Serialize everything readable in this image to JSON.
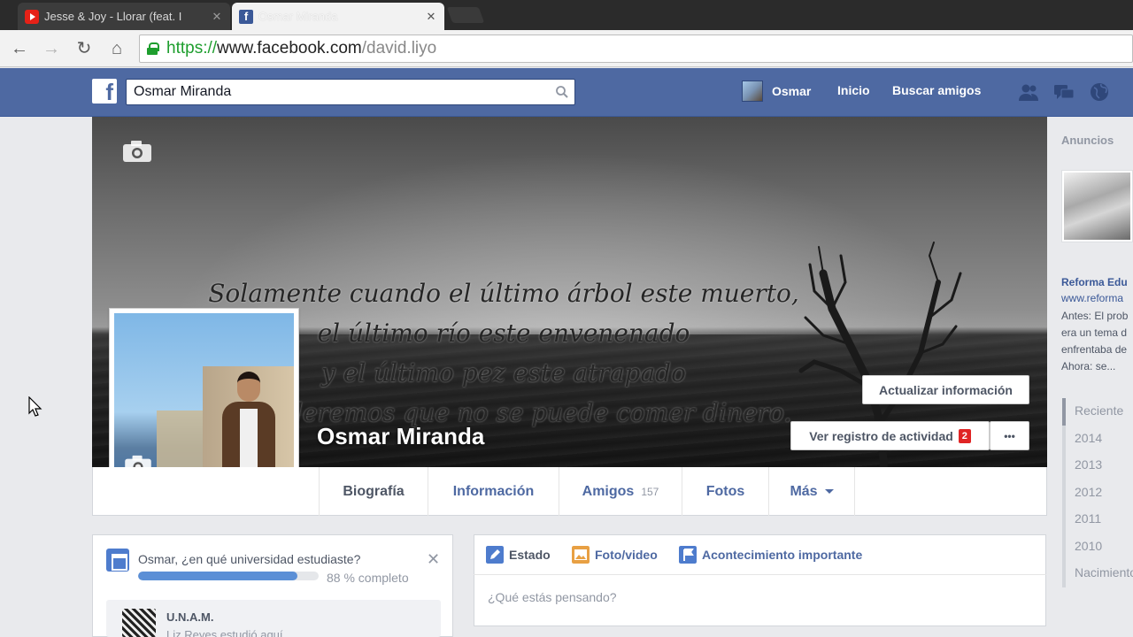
{
  "browser": {
    "tabs": [
      {
        "title": "Jesse & Joy - Llorar (feat. I",
        "active": false
      },
      {
        "title": "Osmar Miranda",
        "active": true
      }
    ],
    "url": {
      "scheme": "https://",
      "host": "www.facebook.com",
      "path": "/david.liyo"
    }
  },
  "fb": {
    "search_value": "Osmar Miranda",
    "user_name": "Osmar",
    "nav": {
      "home": "Inicio",
      "find_friends": "Buscar amigos"
    }
  },
  "cover": {
    "quote_lines": [
      "Solamente cuando el último árbol este muerto,",
      "el último río este envenenado",
      "y el último pez este atrapado",
      "entenderemos que no se puede comer dinero."
    ],
    "update_info_label": "Actualizar información",
    "activity_log_label": "Ver registro de actividad",
    "activity_badge": "2",
    "more_label": "•••"
  },
  "profile": {
    "name": "Osmar Miranda"
  },
  "profile_tabs": [
    {
      "label": "Biografía",
      "count": ""
    },
    {
      "label": "Información",
      "count": ""
    },
    {
      "label": "Amigos",
      "count": "157"
    },
    {
      "label": "Fotos",
      "count": ""
    },
    {
      "label": "Más",
      "count": ""
    }
  ],
  "university_prompt": {
    "question": "Osmar, ¿en qué universidad estudiaste?",
    "progress_percent": 88,
    "progress_label": "88 % completo",
    "suggestion_name": "U.N.A.M.",
    "suggestion_sub": "Liz Reyes estudió aquí"
  },
  "composer": {
    "tabs": [
      "Estado",
      "Foto/video",
      "Acontecimiento importante"
    ],
    "placeholder": "¿Qué estás pensando?"
  },
  "ads": {
    "heading": "Anuncios",
    "title": "Reforma Edu",
    "url": "www.reforma",
    "body_lines": [
      "Antes: El prob",
      "era un tema d",
      "enfrentaba de",
      "Ahora: se..."
    ]
  },
  "timeline_years": [
    "Reciente",
    "2014",
    "2013",
    "2012",
    "2011",
    "2010",
    "Nacimiento"
  ],
  "colors": {
    "fb_blue": "#4e69a2",
    "link": "#3b5998",
    "badge": "#e02424",
    "ssl_green": "#1e9e2e"
  }
}
